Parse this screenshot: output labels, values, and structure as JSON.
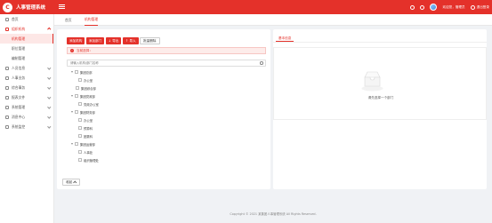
{
  "app": {
    "logo_letter": "C",
    "title": "人事管理系统"
  },
  "header": {
    "user_greeting": "欢迎您，管理员",
    "logout_label": "退出登录"
  },
  "sidebar": {
    "items": [
      {
        "label": "首页"
      },
      {
        "label": "组织机构"
      },
      {
        "label": "机构管理"
      },
      {
        "label": "职位管理"
      },
      {
        "label": "编制管理"
      },
      {
        "label": "人员信息"
      },
      {
        "label": "人事业务"
      },
      {
        "label": "综合事务"
      },
      {
        "label": "报表文件"
      },
      {
        "label": "系统管理"
      },
      {
        "label": "消息中心"
      },
      {
        "label": "系统监控"
      }
    ]
  },
  "tabs": [
    {
      "label": "首页"
    },
    {
      "label": "机构管理"
    }
  ],
  "toolbar": {
    "add_org": "添加机构",
    "add_dept": "添加部门",
    "export": "导出",
    "import": "导入",
    "batch_delete": "批量删除"
  },
  "alert": {
    "text": "当前选择："
  },
  "search": {
    "placeholder": "请输入机构/部门名称"
  },
  "tree": [
    {
      "label": "集团总部",
      "level": 0,
      "type": "branch"
    },
    {
      "label": "办公室",
      "level": 1,
      "type": "leaf"
    },
    {
      "label": "集团综合部",
      "level": 0,
      "type": "leaf"
    },
    {
      "label": "集团党政部",
      "level": 0,
      "type": "branch"
    },
    {
      "label": "党政办公室",
      "level": 1,
      "type": "leaf"
    },
    {
      "label": "集团财务部",
      "level": 0,
      "type": "branch"
    },
    {
      "label": "办公室",
      "level": 1,
      "type": "leaf"
    },
    {
      "label": "预算科",
      "level": 1,
      "type": "leaf"
    },
    {
      "label": "团委科",
      "level": 1,
      "type": "leaf"
    },
    {
      "label": "集团运营部",
      "level": 0,
      "type": "branch"
    },
    {
      "label": "人事处",
      "level": 1,
      "type": "leaf"
    },
    {
      "label": "组织管理处",
      "level": 1,
      "type": "leaf"
    }
  ],
  "collapse": {
    "label": "收起"
  },
  "right_panel": {
    "tab_label": "基本信息",
    "empty_text": "请先选择一个部门"
  },
  "footer": {
    "text": "Copyright © 2021 某集团人事管理系统 All Rights Reserved."
  },
  "colors": {
    "brand": "#e4312a",
    "background": "#f0f2f5"
  }
}
